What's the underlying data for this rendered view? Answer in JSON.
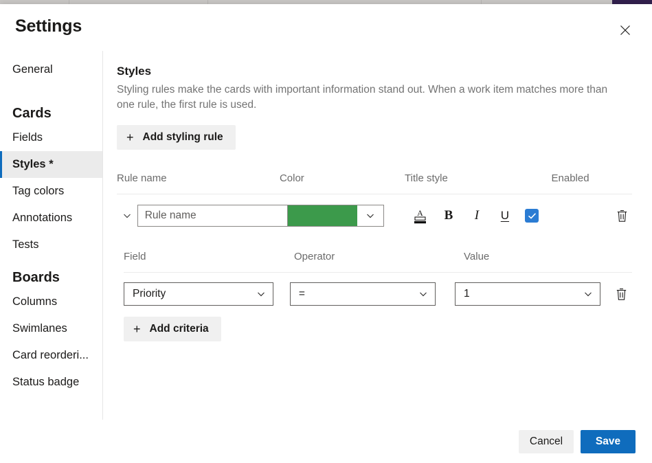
{
  "dialog": {
    "title": "Settings",
    "close_icon": "close-icon"
  },
  "sidebar": {
    "items": [
      {
        "label": "General",
        "type": "item",
        "active": false
      },
      {
        "label": "Cards",
        "type": "group"
      },
      {
        "label": "Fields",
        "type": "item",
        "active": false
      },
      {
        "label": "Styles *",
        "type": "item",
        "active": true
      },
      {
        "label": "Tag colors",
        "type": "item",
        "active": false
      },
      {
        "label": "Annotations",
        "type": "item",
        "active": false
      },
      {
        "label": "Tests",
        "type": "item",
        "active": false
      },
      {
        "label": "Boards",
        "type": "group"
      },
      {
        "label": "Columns",
        "type": "item",
        "active": false
      },
      {
        "label": "Swimlanes",
        "type": "item",
        "active": false
      },
      {
        "label": "Card reorderi...",
        "type": "item",
        "active": false
      },
      {
        "label": "Status badge",
        "type": "item",
        "active": false
      }
    ]
  },
  "main": {
    "section_title": "Styles",
    "section_description": "Styling rules make the cards with important information stand out. When a work item matches more than one rule, the first rule is used.",
    "add_styling_rule_label": "Add styling rule",
    "plus_glyph": "+",
    "rules_table": {
      "headers": {
        "rule_name": "Rule name",
        "color": "Color",
        "title_style": "Title style",
        "enabled": "Enabled"
      },
      "row": {
        "expander_icon": "chevron-down-icon",
        "rule_name_placeholder": "Rule name",
        "rule_name_value": "",
        "color_hex": "#3c9a4b",
        "color_caret_icon": "chevron-down-icon",
        "style_buttons": [
          {
            "name": "font-color-icon",
            "glyph": "A"
          },
          {
            "name": "bold-icon",
            "glyph": "B"
          },
          {
            "name": "italic-icon",
            "glyph": "I"
          },
          {
            "name": "underline-icon",
            "glyph": "U"
          }
        ],
        "enabled_checked": true,
        "delete_icon": "trash-icon"
      }
    },
    "criteria_table": {
      "headers": {
        "field": "Field",
        "operator": "Operator",
        "value": "Value"
      },
      "row": {
        "field_value": "Priority",
        "operator_value": "=",
        "value_value": "1",
        "caret_icon": "chevron-down-icon",
        "delete_icon": "trash-icon"
      }
    },
    "add_criteria_label": "Add criteria"
  },
  "footer": {
    "cancel_label": "Cancel",
    "save_label": "Save"
  },
  "colors": {
    "accent_blue": "#0f6cbd",
    "checkbox_blue": "#2b7cd3",
    "rule_green": "#3c9a4b",
    "selected_nav_bg": "#ebebeb"
  }
}
